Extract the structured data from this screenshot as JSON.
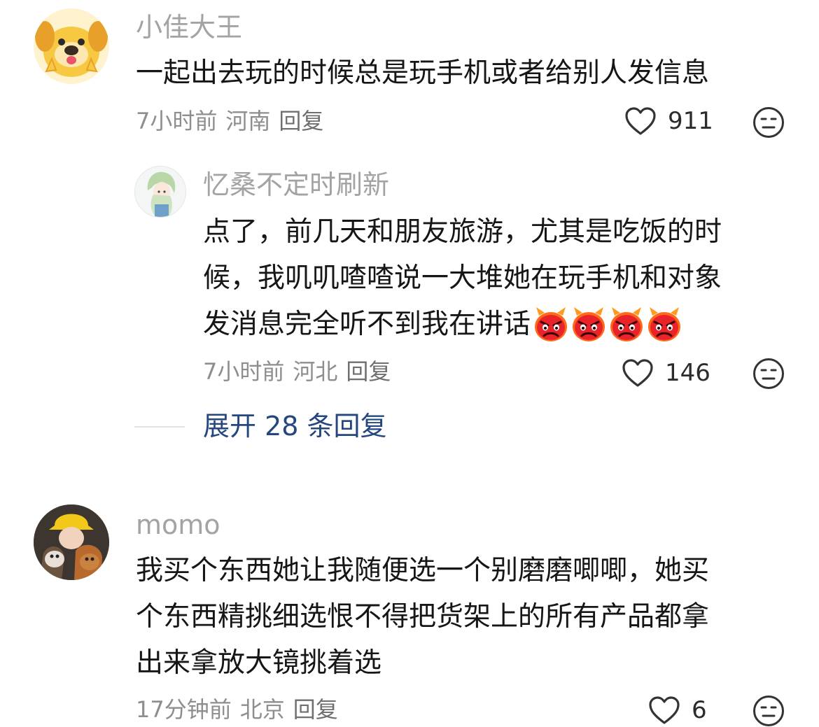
{
  "comments": [
    {
      "username": "小佳大王",
      "text": "一起出去玩的时候总是玩手机或者给别人发信息",
      "time": "7小时前",
      "location": "河南",
      "reply_label": "回复",
      "likes": "911",
      "avatar_icon": "yellow-dog-avatar",
      "replies": [
        {
          "username": "忆桑不定时刷新",
          "text_line1": "点了，前几天和朋友旅游，尤其是吃饭的时",
          "text_line2": "候，我叽叽喳喳说一大堆她在玩手机和对象",
          "text_line3": "发消息完全听不到我在讲话",
          "emoji_icon": "angry-devil-emoji",
          "emoji_count": 4,
          "time": "7小时前",
          "location": "河北",
          "reply_label": "回复",
          "likes": "146",
          "avatar_icon": "anime-character-avatar"
        }
      ],
      "expand_label": "展开 28 条回复"
    },
    {
      "username": "momo",
      "text_line1": "我买个东西她让我随便选一个别磨磨唧唧，她买",
      "text_line2": "个东西精挑细选恨不得把货架上的所有产品都拿",
      "text_line3": "出来拿放大镜挑着选",
      "time": "17分钟前",
      "location": "北京",
      "reply_label": "回复",
      "likes": "6",
      "avatar_icon": "girl-with-dogs-avatar"
    }
  ],
  "colors": {
    "username": "#a3a3a3",
    "body_text": "#161616",
    "meta": "#8e8e8e",
    "link": "#24477f"
  }
}
